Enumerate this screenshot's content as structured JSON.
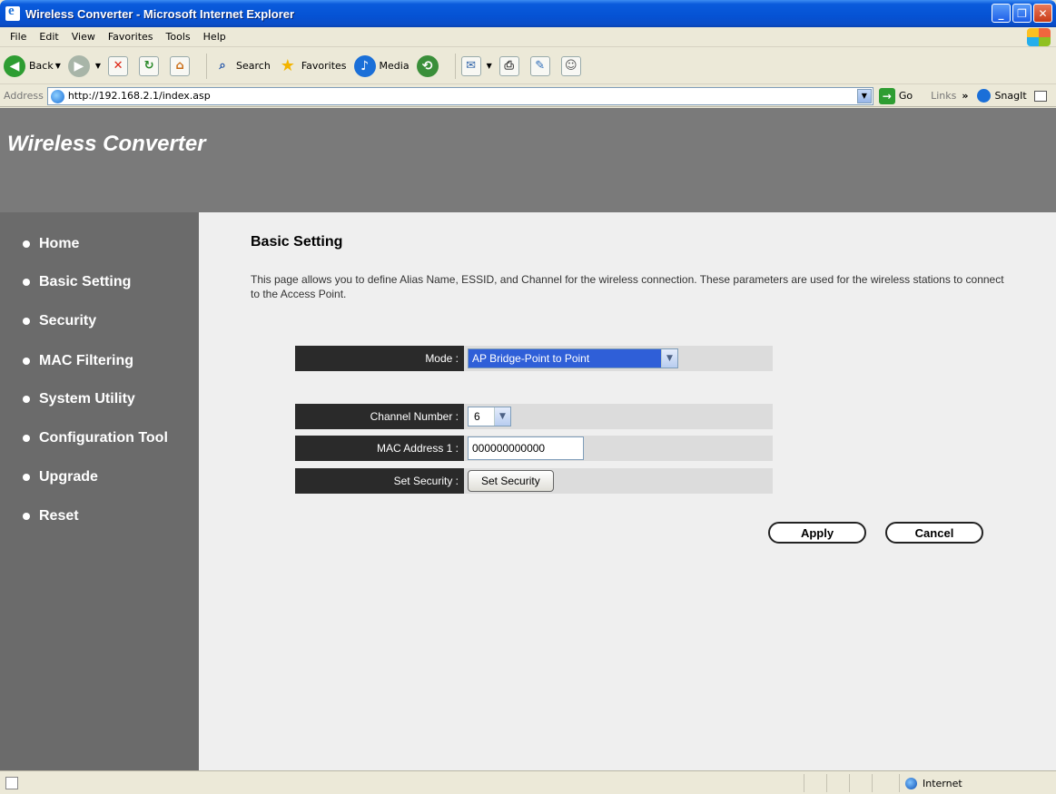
{
  "window": {
    "title": "Wireless Converter - Microsoft Internet Explorer"
  },
  "menu": [
    "File",
    "Edit",
    "View",
    "Favorites",
    "Tools",
    "Help"
  ],
  "toolbar": {
    "back_label": "Back",
    "search_label": "Search",
    "favorites_label": "Favorites",
    "media_label": "Media"
  },
  "address": {
    "label": "Address",
    "url": "http://192.168.2.1/index.asp",
    "go_label": "Go",
    "links_label": "Links",
    "snagit_label": "SnagIt"
  },
  "header": {
    "brand": "Wireless Converter"
  },
  "sidebar": {
    "items": [
      {
        "label": "Home"
      },
      {
        "label": "Basic Setting"
      },
      {
        "label": "Security"
      },
      {
        "label": "MAC Filtering"
      },
      {
        "label": "System Utility"
      },
      {
        "label": "Configuration Tool"
      },
      {
        "label": "Upgrade"
      },
      {
        "label": "Reset"
      }
    ]
  },
  "main": {
    "title": "Basic Setting",
    "description": "This page allows you to define Alias Name, ESSID, and Channel for the wireless connection. These parameters are used for the wireless stations to connect to the Access Point.",
    "form": {
      "mode_label": "Mode :",
      "mode_value": "AP Bridge-Point to Point",
      "channel_label": "Channel Number :",
      "channel_value": "6",
      "mac_label": "MAC Address 1 :",
      "mac_value": "000000000000",
      "security_label": "Set Security :",
      "security_button": "Set Security"
    },
    "apply_label": "Apply",
    "cancel_label": "Cancel"
  },
  "status": {
    "zone": "Internet"
  }
}
